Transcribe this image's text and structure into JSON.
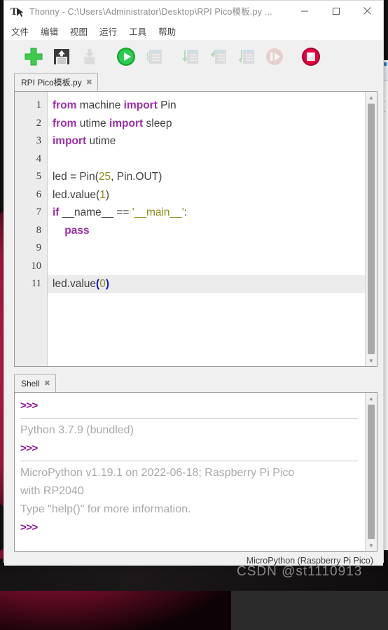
{
  "window": {
    "app_name": "Thonny",
    "title": "Thonny  -  C:\\Users\\Administrator\\Desktop\\RPI Pico模板.py  ...",
    "icon": "thonny-icon",
    "minimize": "—",
    "maximize": "☐",
    "close": "✕"
  },
  "menubar": {
    "items": [
      {
        "label": "文件",
        "name": "menu-file"
      },
      {
        "label": "编辑",
        "name": "menu-edit"
      },
      {
        "label": "视图",
        "name": "menu-view"
      },
      {
        "label": "运行",
        "name": "menu-run"
      },
      {
        "label": "工具",
        "name": "menu-tools"
      },
      {
        "label": "帮助",
        "name": "menu-help"
      }
    ]
  },
  "toolbar": {
    "buttons": [
      {
        "name": "new-file-icon",
        "title": "新建",
        "enabled": true
      },
      {
        "name": "save-file-icon",
        "title": "保存",
        "enabled": true
      },
      {
        "name": "load-file-icon",
        "title": "打开",
        "enabled": false
      },
      {
        "name": "run-icon",
        "title": "运行",
        "enabled": true
      },
      {
        "name": "debug-icon",
        "title": "调试",
        "enabled": false
      },
      {
        "name": "step-over-icon",
        "title": "单步跳过",
        "enabled": false
      },
      {
        "name": "step-into-icon",
        "title": "单步进入",
        "enabled": false
      },
      {
        "name": "step-out-icon",
        "title": "单步跳出",
        "enabled": false
      },
      {
        "name": "resume-icon",
        "title": "继续",
        "enabled": false
      },
      {
        "name": "stop-icon",
        "title": "停止",
        "enabled": true
      }
    ]
  },
  "editor": {
    "tab": {
      "label": "RPI Pico模板.py",
      "close": "✖"
    },
    "current_line": 11,
    "lines": [
      {
        "n": "1",
        "tokens": [
          {
            "t": "from",
            "c": "kw"
          },
          {
            "t": " machine ",
            "c": ""
          },
          {
            "t": "import",
            "c": "kw"
          },
          {
            "t": " Pin",
            "c": ""
          }
        ]
      },
      {
        "n": "2",
        "tokens": [
          {
            "t": "from",
            "c": "kw"
          },
          {
            "t": " utime ",
            "c": ""
          },
          {
            "t": "import",
            "c": "kw"
          },
          {
            "t": " sleep",
            "c": ""
          }
        ]
      },
      {
        "n": "3",
        "tokens": [
          {
            "t": "import",
            "c": "kw"
          },
          {
            "t": " utime",
            "c": ""
          }
        ]
      },
      {
        "n": "4",
        "tokens": []
      },
      {
        "n": "5",
        "tokens": [
          {
            "t": "led = Pin(",
            "c": ""
          },
          {
            "t": "25",
            "c": "num"
          },
          {
            "t": ", Pin.OUT)",
            "c": ""
          }
        ]
      },
      {
        "n": "6",
        "tokens": [
          {
            "t": "led.value(",
            "c": ""
          },
          {
            "t": "1",
            "c": "num"
          },
          {
            "t": ")",
            "c": ""
          }
        ]
      },
      {
        "n": "7",
        "tokens": [
          {
            "t": "if",
            "c": "kw"
          },
          {
            "t": " __name__ == ",
            "c": ""
          },
          {
            "t": "'__main__'",
            "c": "str"
          },
          {
            "t": ":",
            "c": ""
          }
        ]
      },
      {
        "n": "8",
        "tokens": [
          {
            "t": "    ",
            "c": ""
          },
          {
            "t": "pass",
            "c": "kw"
          }
        ]
      },
      {
        "n": "9",
        "tokens": []
      },
      {
        "n": "10",
        "tokens": []
      },
      {
        "n": "11",
        "tokens": [
          {
            "t": "led.value",
            "c": ""
          },
          {
            "t": "(",
            "c": "brk"
          },
          {
            "t": "0",
            "c": "num"
          },
          {
            "t": ")",
            "c": "brk"
          }
        ]
      }
    ]
  },
  "shell": {
    "tab": {
      "label": "Shell",
      "close": "✖"
    },
    "entries": [
      {
        "type": "prompt",
        "text": ">>>"
      },
      {
        "type": "separator"
      },
      {
        "type": "output",
        "text": "Python 3.7.9 (bundled)"
      },
      {
        "type": "prompt",
        "text": ">>>"
      },
      {
        "type": "separator"
      },
      {
        "type": "output",
        "text": "MicroPython v1.19.1 on 2022-06-18; Raspberry Pi Pico"
      },
      {
        "type": "output",
        "text": "with RP2040"
      },
      {
        "type": "output",
        "text": "Type \"help()\" for more information."
      },
      {
        "type": "prompt",
        "text": ">>>"
      }
    ]
  },
  "statusbar": {
    "interpreter": "MicroPython (Raspberry Pi Pico)"
  },
  "watermark": {
    "text": "CSDN @st1110913"
  },
  "colors": {
    "keyword": "#9b30a8",
    "number": "#8c8c18",
    "string": "#8c8c18",
    "bracket": "#1414d2",
    "prompt": "#8c0a8c",
    "output": "#a9a9a9",
    "accent_green": "#2ebd4e",
    "accent_red": "#d00a3c"
  }
}
